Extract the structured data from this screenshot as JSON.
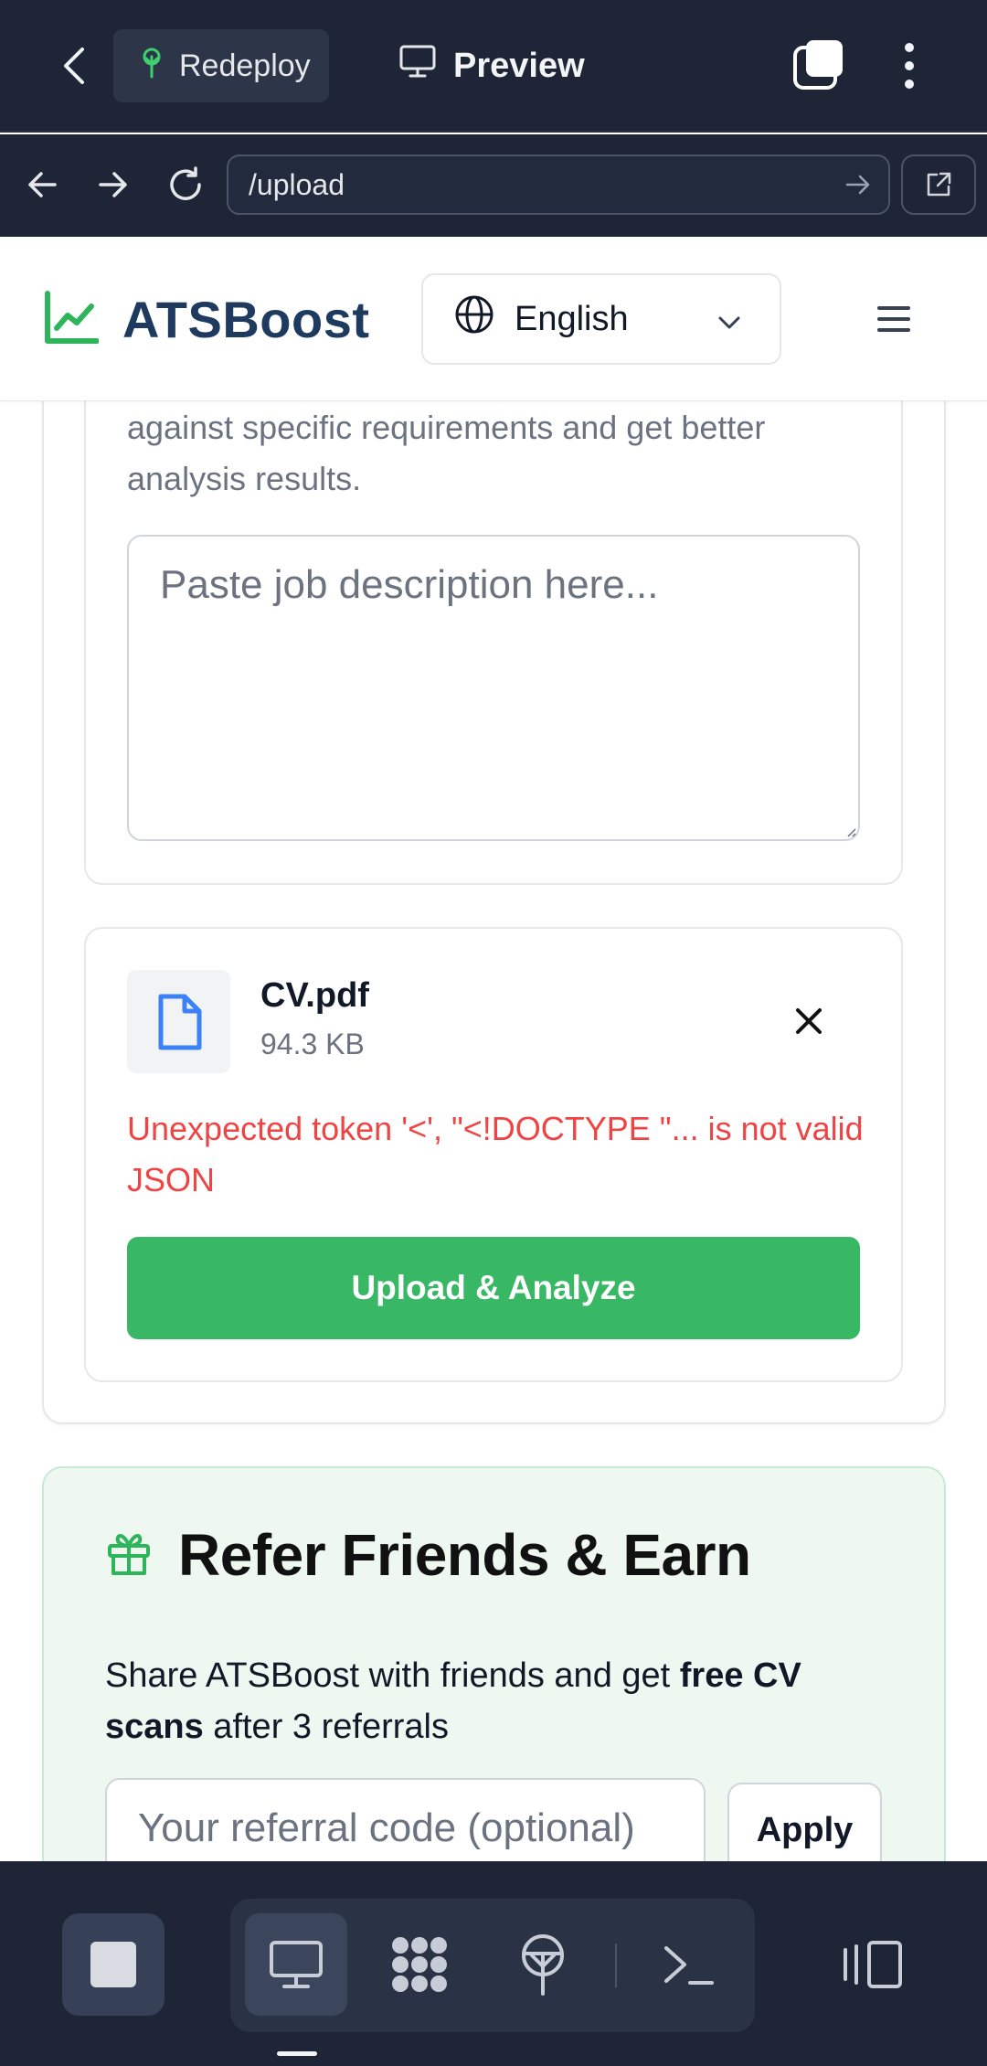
{
  "app_bar": {
    "redeploy_label": "Redeploy",
    "preview_label": "Preview",
    "icons": [
      "back-arrow-icon",
      "sprout-icon",
      "monitor-icon",
      "tabs-icon",
      "more-vertical-icon"
    ]
  },
  "browser": {
    "url": "/upload",
    "icons": [
      "back-icon",
      "forward-icon",
      "reload-icon",
      "go-arrow-icon",
      "open-external-icon"
    ]
  },
  "site_header": {
    "brand": "ATSBoost",
    "language": "English",
    "icons": [
      "trend-chart-icon",
      "globe-icon",
      "chevron-down-icon",
      "hamburger-menu-icon"
    ]
  },
  "job_description": {
    "help_text": "against specific requirements and get better analysis results.",
    "placeholder": "Paste job description here...",
    "value": ""
  },
  "upload": {
    "file_name": "CV.pdf",
    "file_size": "94.3 KB",
    "error": "Unexpected token '<', \"<!DOCTYPE \"... is not valid JSON",
    "button_label": "Upload & Analyze",
    "accent_color": "#38b865",
    "error_color": "#ef4444"
  },
  "referral": {
    "title": "Refer Friends & Earn",
    "desc_prefix": "Share ATSBoost with friends and get ",
    "desc_bold": "free CV scans",
    "desc_suffix": " after 3 referrals",
    "input_placeholder": "Your referral code (optional)",
    "apply_label": "Apply"
  },
  "bottom_bar": {
    "icons": [
      "stop-icon",
      "desktop-icon",
      "apps-icon",
      "deploy-icon",
      "terminal-icon",
      "split-view-icon"
    ]
  }
}
